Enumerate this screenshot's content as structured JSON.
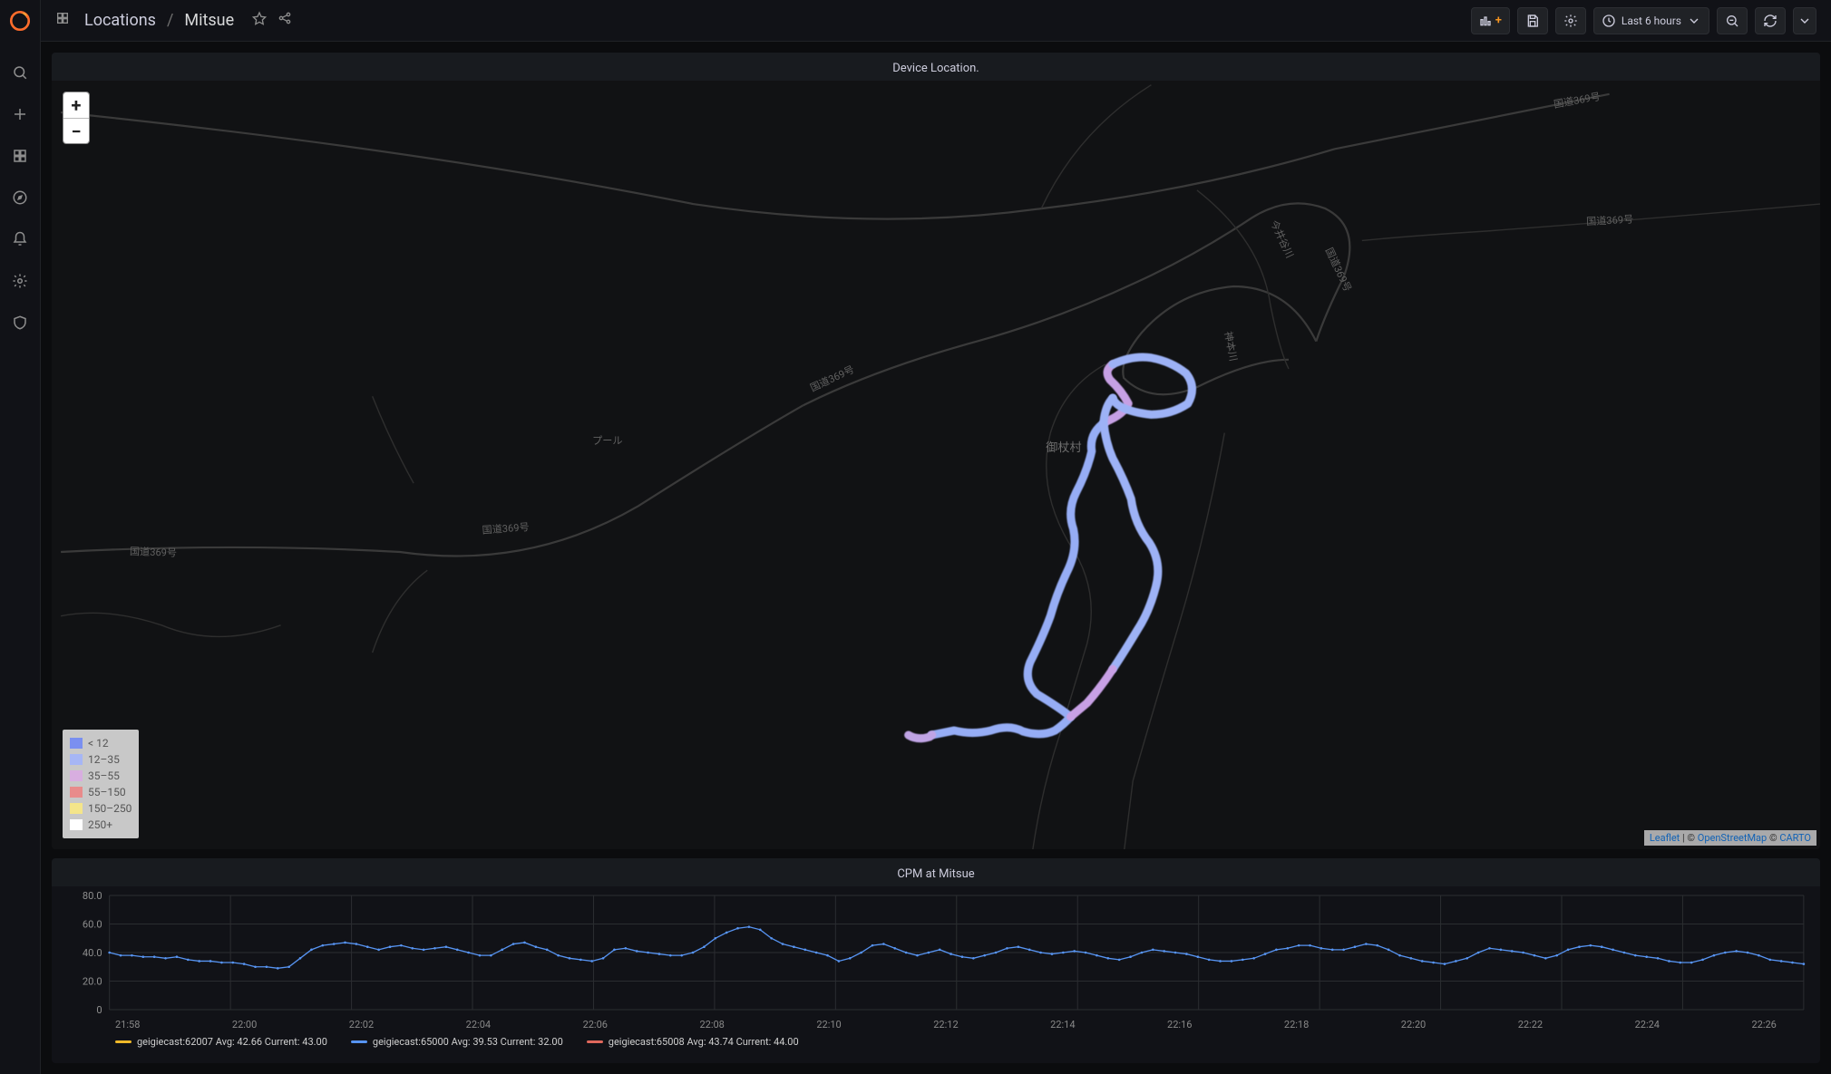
{
  "breadcrumb": {
    "parent": "Locations",
    "current": "Mitsue"
  },
  "topbar": {
    "time_range": "Last 6 hours"
  },
  "map_panel": {
    "title": "Device Location.",
    "place_label_1": "御杖村",
    "place_label_2": "プール",
    "road_labels": [
      "国道369号",
      "国道369号",
      "国道369号",
      "国道369号",
      "国道369号",
      "国道369号",
      "神本川",
      "今井谷川"
    ],
    "zoom_in": "+",
    "zoom_out": "−",
    "attribution": {
      "leaflet": "Leaflet",
      "sep1": " | © ",
      "osm": "OpenStreetMap",
      "sep2": " © ",
      "carto": "CARTO"
    },
    "legend": [
      {
        "color": "#7a8ff0",
        "label": "< 12"
      },
      {
        "color": "#a6b6f5",
        "label": "12–35"
      },
      {
        "color": "#d8aee0",
        "label": "35–55"
      },
      {
        "color": "#e88b8b",
        "label": "55–150"
      },
      {
        "color": "#f4e58a",
        "label": "150–250"
      },
      {
        "color": "#ffffff",
        "label": "250+"
      }
    ]
  },
  "chart_panel": {
    "title": "CPM at Mitsue",
    "legend": [
      {
        "name": "geigiecast:62007",
        "color": "#f0b929",
        "avg_label": "Avg:",
        "avg": "42.66",
        "cur_label": "Current:",
        "cur": "43.00"
      },
      {
        "name": "geigiecast:65000",
        "color": "#5794f2",
        "avg_label": "Avg:",
        "avg": "39.53",
        "cur_label": "Current:",
        "cur": "32.00"
      },
      {
        "name": "geigiecast:65008",
        "color": "#e0685c",
        "avg_label": "Avg:",
        "avg": "43.74",
        "cur_label": "Current:",
        "cur": "44.00"
      }
    ]
  },
  "chart_data": {
    "type": "line",
    "title": "CPM at Mitsue",
    "xlabel": "",
    "ylabel": "",
    "ylim": [
      0,
      80
    ],
    "y_ticks": [
      "0",
      "20.0",
      "40.0",
      "60.0",
      "80.0"
    ],
    "x_ticks": [
      "21:58",
      "22:00",
      "22:02",
      "22:04",
      "22:06",
      "22:08",
      "22:10",
      "22:12",
      "22:14",
      "22:16",
      "22:18",
      "22:20",
      "22:22",
      "22:24",
      "22:26"
    ],
    "series": [
      {
        "name": "geigiecast:65000",
        "color": "#5794f2",
        "values": [
          40,
          38,
          38,
          37,
          37,
          36,
          37,
          35,
          34,
          34,
          33,
          33,
          32,
          30,
          30,
          29,
          30,
          36,
          42,
          45,
          46,
          47,
          46,
          44,
          42,
          44,
          45,
          43,
          42,
          43,
          44,
          42,
          40,
          38,
          38,
          42,
          46,
          47,
          44,
          42,
          38,
          36,
          35,
          34,
          36,
          42,
          43,
          41,
          40,
          39,
          38,
          38,
          40,
          44,
          50,
          54,
          57,
          58,
          56,
          50,
          46,
          44,
          42,
          40,
          38,
          34,
          36,
          40,
          45,
          46,
          43,
          40,
          38,
          40,
          42,
          39,
          37,
          36,
          38,
          40,
          43,
          44,
          42,
          40,
          39,
          40,
          41,
          40,
          38,
          36,
          35,
          37,
          40,
          42,
          41,
          40,
          39,
          37,
          35,
          34,
          34,
          35,
          36,
          39,
          42,
          43,
          45,
          45,
          43,
          42,
          42,
          44,
          46,
          45,
          42,
          38,
          36,
          34,
          33,
          32,
          34,
          36,
          40,
          43,
          42,
          41,
          40,
          38,
          36,
          38,
          42,
          44,
          45,
          44,
          42,
          40,
          38,
          37,
          36,
          34,
          33,
          33,
          35,
          38,
          40,
          41,
          40,
          38,
          35,
          34,
          33,
          32
        ]
      }
    ]
  }
}
